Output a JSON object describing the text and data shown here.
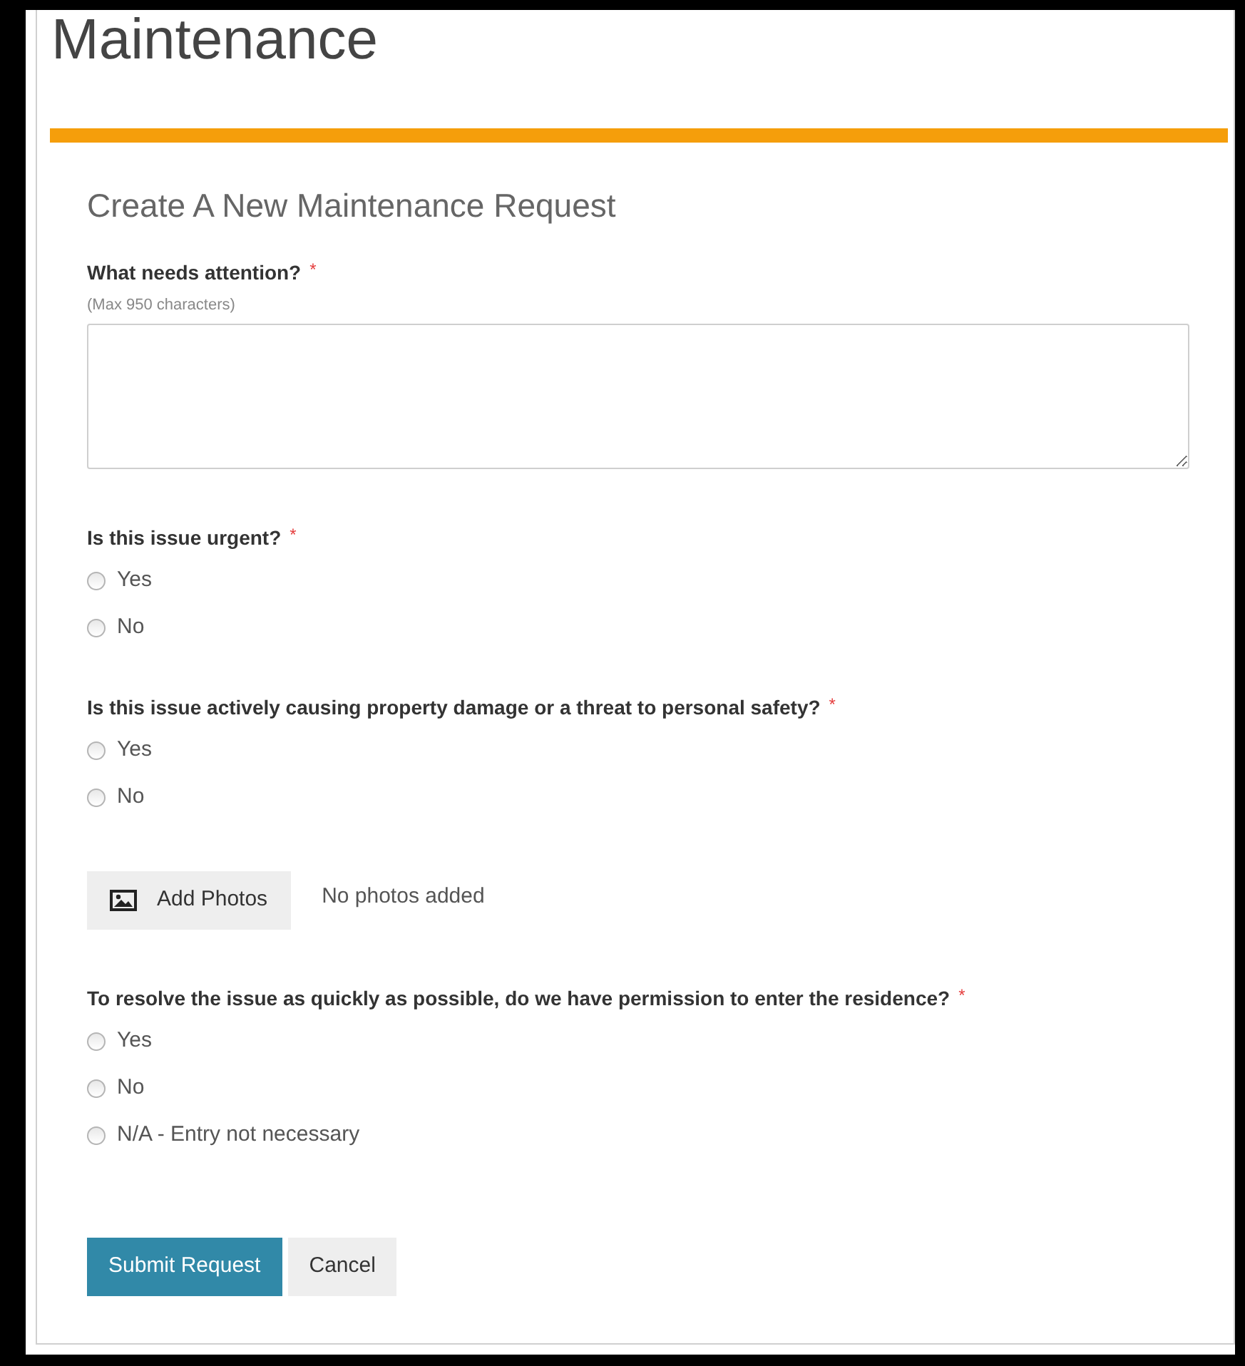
{
  "page_title": "Maintenance",
  "form": {
    "title": "Create A New Maintenance Request",
    "fields": [
      {
        "kind": "textarea",
        "label": "What needs attention?",
        "required_mark": "*",
        "hint": "(Max 950 characters)"
      },
      {
        "kind": "radio",
        "label": "Is this issue urgent?",
        "required_mark": "*",
        "options": [
          {
            "label": "Yes",
            "selected": false
          },
          {
            "label": "No",
            "selected": false
          }
        ]
      },
      {
        "kind": "radio",
        "label": "Is this issue actively causing property damage or a threat to personal safety?",
        "required_mark": "*",
        "options": [
          {
            "label": "Yes",
            "selected": false
          },
          {
            "label": "No",
            "selected": false
          }
        ]
      },
      {
        "kind": "photos",
        "button": "Add Photos",
        "status": "No photos added"
      },
      {
        "kind": "radio",
        "label": "To resolve the issue as quickly as possible, do we have permission to enter the residence?",
        "required_mark": "*",
        "options": [
          {
            "label": "Yes",
            "selected": false
          },
          {
            "label": "No",
            "selected": false
          },
          {
            "label": "N/A - Entry not necessary",
            "selected": false
          }
        ]
      }
    ],
    "buttons": [
      {
        "kind": "primary",
        "label": "Submit Request"
      },
      {
        "kind": "secondary",
        "label": "Cancel"
      }
    ]
  }
}
